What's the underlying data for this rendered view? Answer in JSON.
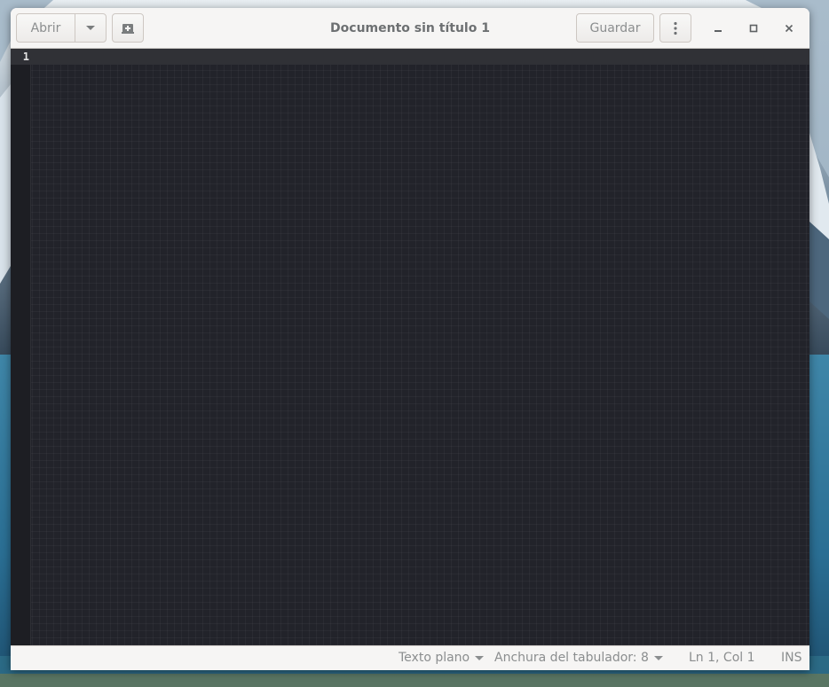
{
  "headerbar": {
    "open_label": "Abrir",
    "open_menu_icon": "pan-down-icon",
    "new_tab_icon": "tab-new-icon",
    "title": "Documento sin título 1",
    "save_label": "Guardar",
    "menu_icon": "view-more-icon",
    "minimize_icon": "minimize-icon",
    "maximize_icon": "maximize-icon",
    "close_icon": "close-icon"
  },
  "editor": {
    "line_numbers": [
      "1"
    ],
    "content": ""
  },
  "statusbar": {
    "language": "Texto plano",
    "tab_width": "Anchura del tabulador: 8",
    "cursor_position": "Ln 1, Col 1",
    "insert_mode": "INS"
  },
  "colors": {
    "editor_background": "#22232a",
    "current_line": "#303136",
    "headerbar_background": "#f6f5f4",
    "text_muted": "#8b8e8f"
  }
}
